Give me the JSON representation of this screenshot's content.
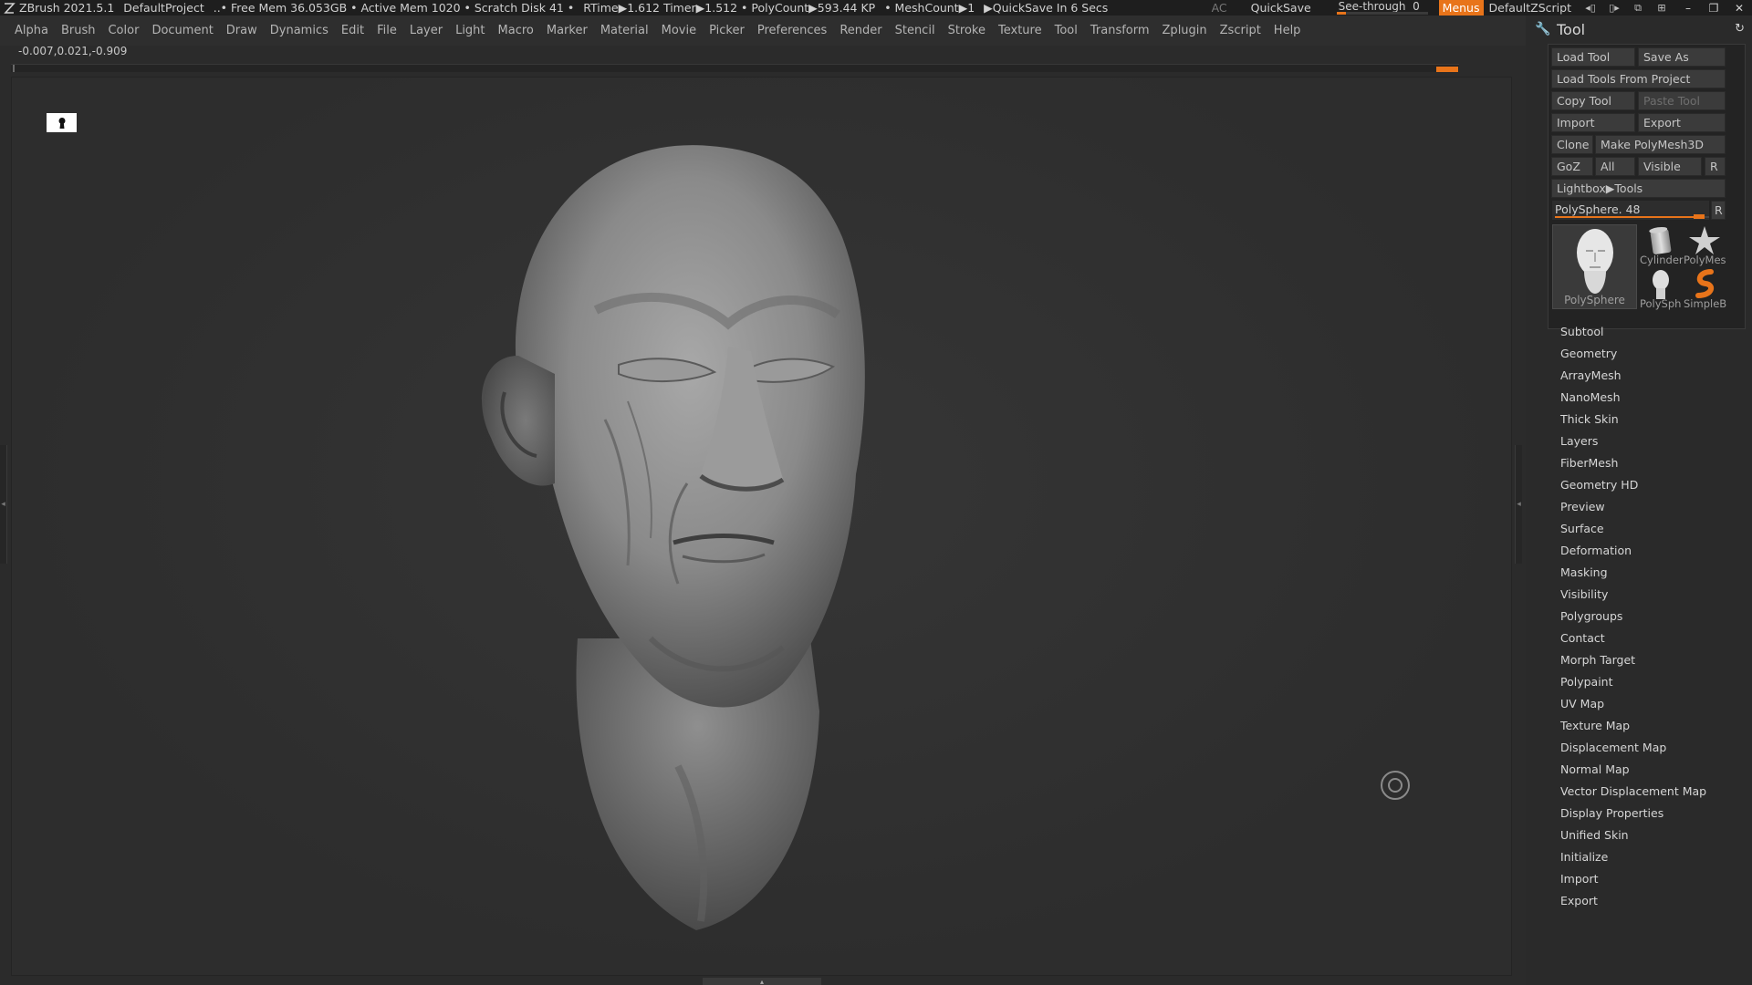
{
  "titlebar": {
    "app": "ZBrush 2021.5.1",
    "project": "DefaultProject",
    "stats": "..• Free Mem 36.053GB • Active Mem 1020 • Scratch Disk 41 •",
    "rtime": "RTime▶1.612 Timer▶1.512 • PolyCount▶593.44 KP",
    "meshcount": "• MeshCount▶1",
    "quicksave_timer": "▶QuickSave In 6 Secs",
    "ac": "AC",
    "quicksave": "QuickSave",
    "see_through_label": "See-through",
    "see_through_value": "0",
    "see_through_level": 0.1,
    "menus": "Menus",
    "zscript": "DefaultZScript",
    "accent_color": "#e8741a"
  },
  "menubar": {
    "items": [
      "Alpha",
      "Brush",
      "Color",
      "Document",
      "Draw",
      "Dynamics",
      "Edit",
      "File",
      "Layer",
      "Light",
      "Macro",
      "Marker",
      "Material",
      "Movie",
      "Picker",
      "Preferences",
      "Render",
      "Stencil",
      "Stroke",
      "Texture",
      "Tool",
      "Transform",
      "Zplugin",
      "Zscript",
      "Help"
    ]
  },
  "coords": "-0.007,0.021,-0.909",
  "tool_palette": {
    "title": "Tool",
    "buttons": {
      "load_tool": "Load Tool",
      "save_as": "Save As",
      "load_from_project": "Load Tools From Project",
      "copy_tool": "Copy Tool",
      "paste_tool": "Paste Tool",
      "import": "Import",
      "export": "Export",
      "clone": "Clone",
      "make_polymesh": "Make PolyMesh3D",
      "goz": "GoZ",
      "all": "All",
      "visible": "Visible",
      "r": "R",
      "lightbox": "Lightbox▶Tools"
    },
    "current_tool": "PolySphere. 48",
    "current_tool_level": 0.97,
    "thumbnails": {
      "main": "PolySphere",
      "cylinder": "Cylinder",
      "polymesh": "PolyMes",
      "polysph": "PolySph",
      "simpleb": "SimpleB"
    },
    "subpalettes": [
      "Subtool",
      "Geometry",
      "ArrayMesh",
      "NanoMesh",
      "Thick Skin",
      "Layers",
      "FiberMesh",
      "Geometry HD",
      "Preview",
      "Surface",
      "Deformation",
      "Masking",
      "Visibility",
      "Polygroups",
      "Contact",
      "Morph Target",
      "Polypaint",
      "UV Map",
      "Texture Map",
      "Displacement Map",
      "Normal Map",
      "Vector Displacement Map",
      "Display Properties",
      "Unified Skin",
      "Initialize",
      "Import",
      "Export"
    ]
  }
}
